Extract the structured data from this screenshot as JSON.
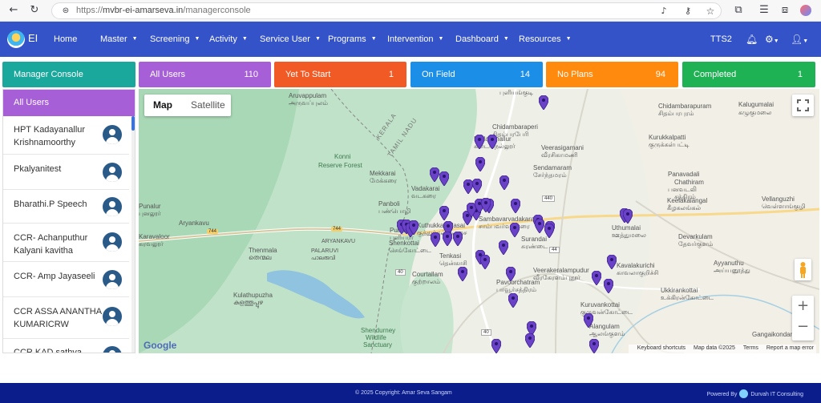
{
  "browser": {
    "url_prefix": "https://",
    "url_host": "mvbr-ei-amarseva.in",
    "url_path": "/managerconsole"
  },
  "navbar": {
    "brand": "EI",
    "items": [
      {
        "label": "Home"
      },
      {
        "label": "Master"
      },
      {
        "label": "Screening"
      },
      {
        "label": "Activity"
      },
      {
        "label": "Service User"
      },
      {
        "label": "Programs"
      },
      {
        "label": "Intervention"
      },
      {
        "label": "Dashboard"
      },
      {
        "label": "Resources"
      }
    ],
    "user_code": "TTS2",
    "bg_color": "#3453c8"
  },
  "cards": [
    {
      "label": "Manager Console",
      "count": "",
      "color": "#1aa89c"
    },
    {
      "label": "All Users",
      "count": "110",
      "color": "#a65fd6"
    },
    {
      "label": "Yet To Start",
      "count": "1",
      "color": "#f15a24"
    },
    {
      "label": "On Field",
      "count": "14",
      "color": "#1b8ee8"
    },
    {
      "label": "No Plans",
      "count": "94",
      "color": "#ff8a0d"
    },
    {
      "label": "Completed",
      "count": "1",
      "color": "#1fb255"
    }
  ],
  "sidebar": {
    "header": "All Users",
    "users": [
      {
        "name": "HPT Kadayanallur Krishnamoorthy"
      },
      {
        "name": "Pkalyanitest"
      },
      {
        "name": "Bharathi.P Speech"
      },
      {
        "name": "CCR- Achanputhur Kalyani kavitha"
      },
      {
        "name": "CCR- Amp Jayaseeli"
      },
      {
        "name": "CCR ASSA ANANTHA KUMARICRW"
      },
      {
        "name": "CCR KAD sathya"
      }
    ]
  },
  "map": {
    "type_map": "Map",
    "type_satellite": "Satellite",
    "google": "Google",
    "attribution": {
      "shortcuts": "Keyboard shortcuts",
      "data": "Map data ©2025",
      "terms": "Terms",
      "report": "Report a map error"
    },
    "labels": [
      {
        "text": "புளியங்குடி"
      },
      {
        "text": "Aruvappulam"
      },
      {
        "text": "அருவப்புலம்"
      },
      {
        "text": "Chidambarapuram"
      },
      {
        "text": "சிதம்பரபுரம்"
      },
      {
        "text": "Kalugumalai"
      },
      {
        "text": "கழுகுமலை"
      },
      {
        "text": "Chidambaraperi"
      },
      {
        "text": "சிதம்பரபேரி"
      },
      {
        "text": "Kurukkalpatti"
      },
      {
        "text": "குருக்கள்பட்டி"
      },
      {
        "text": "Kadayanallur"
      },
      {
        "text": "கடையநல்லூர்"
      },
      {
        "text": "Veerasigamani"
      },
      {
        "text": "வீரசிகாமணி"
      },
      {
        "text": "KERALA"
      },
      {
        "text": "TAMIL NADU"
      },
      {
        "text": "Konni"
      },
      {
        "text": "Reserve Forest"
      },
      {
        "text": "Sendamaram"
      },
      {
        "text": "சேர்ந்தமரம்"
      },
      {
        "text": "Panavadali"
      },
      {
        "text": "Chathiram"
      },
      {
        "text": "பனவடலி"
      },
      {
        "text": "சத்திரம்"
      },
      {
        "text": "Mekkarai"
      },
      {
        "text": "மேக்கரை"
      },
      {
        "text": "Vadakarai"
      },
      {
        "text": "வடகரை"
      },
      {
        "text": "Keelakalangal"
      },
      {
        "text": "கீழகலங்கல்"
      },
      {
        "text": "Vellanguzhi"
      },
      {
        "text": "வெள்ளாங்குழி"
      },
      {
        "text": "Panboli"
      },
      {
        "text": "பண்பொழி"
      },
      {
        "text": "Sambavarvadakarai"
      },
      {
        "text": "சாம்பவர்வடகரை"
      },
      {
        "text": "Punalur"
      },
      {
        "text": "புனலூர்"
      },
      {
        "text": "Aryankavu"
      },
      {
        "text": "Kuthukkalvalasai"
      },
      {
        "text": "குத்துக்கல்வலசை"
      },
      {
        "text": "Uthumalai"
      },
      {
        "text": "ஊத்துமலை"
      },
      {
        "text": "Karavaloor"
      },
      {
        "text": "கரவலூர்"
      },
      {
        "text": "ARYANKAVU"
      },
      {
        "text": "Puliyara"
      },
      {
        "text": "புளியரா"
      },
      {
        "text": "Shenkottai"
      },
      {
        "text": "செங்கோட்டை"
      },
      {
        "text": "Tenkasi"
      },
      {
        "text": "தென்காசி"
      },
      {
        "text": "Surandai"
      },
      {
        "text": "சுரண்டை"
      },
      {
        "text": "Devarkulam"
      },
      {
        "text": "தேவர்குளம்"
      },
      {
        "text": "Thenmala"
      },
      {
        "text": "തെന്മല"
      },
      {
        "text": "PALARUVI"
      },
      {
        "text": "പാലരുവി"
      },
      {
        "text": "Kavalakurichi"
      },
      {
        "text": "காவலாகுறிச்சி"
      },
      {
        "text": "Veerakeralampudur"
      },
      {
        "text": "வீரகேரளம்புதூர்"
      },
      {
        "text": "Courtallam"
      },
      {
        "text": "குற்றாலம்"
      },
      {
        "text": "Pavoorchatram"
      },
      {
        "text": "பாவூர்சத்திரம்"
      },
      {
        "text": "Ayyanuthu"
      },
      {
        "text": "அய்யனூத்து"
      },
      {
        "text": "Kulathupuzha"
      },
      {
        "text": "കുളത്തൂപ്പുഴ"
      },
      {
        "text": "Ukkirankottai"
      },
      {
        "text": "உக்கிரன்கோட்டை"
      },
      {
        "text": "Kuruvankottai"
      },
      {
        "text": "குருவன்கோட்டை"
      },
      {
        "text": "Alangulam"
      },
      {
        "text": "ஆலங்குளம்"
      },
      {
        "text": "Shendurney"
      },
      {
        "text": "Wildlife"
      },
      {
        "text": "Sanctuary"
      },
      {
        "text": "Gangaikondan"
      }
    ],
    "roads": [
      {
        "text": "744"
      },
      {
        "text": "744"
      },
      {
        "text": "40"
      },
      {
        "text": "440"
      },
      {
        "text": "44"
      },
      {
        "text": "40"
      }
    ]
  },
  "footer": {
    "copyright": "© 2025 Copyright: Amar Seva Sangam",
    "powered_by": "Powered By",
    "company": "Durvah IT Consulting"
  }
}
